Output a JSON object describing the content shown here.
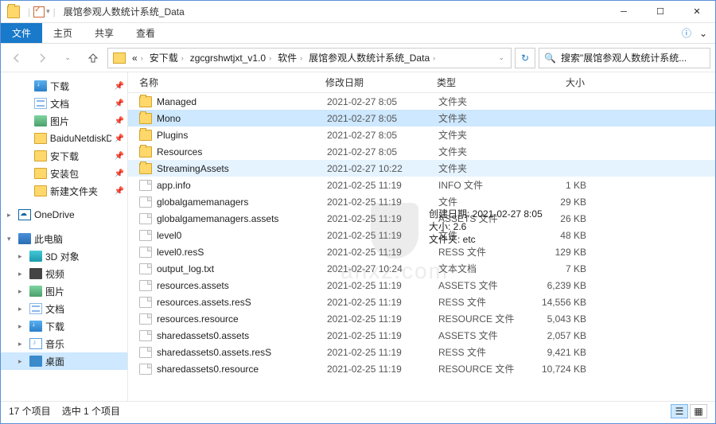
{
  "title": "展馆参观人数统计系统_Data",
  "ribbon": {
    "file": "文件",
    "home": "主页",
    "share": "共享",
    "view": "查看"
  },
  "breadcrumb": [
    "安下载",
    "zgcgrshwtjxt_v1.0",
    "软件",
    "展馆参观人数统计系统_Data"
  ],
  "search_placeholder": "搜索\"展馆参观人数统计系统...",
  "tree": {
    "quick": [
      {
        "label": "下载",
        "icon": "dl",
        "pin": true
      },
      {
        "label": "文档",
        "icon": "doc",
        "pin": true
      },
      {
        "label": "图片",
        "icon": "img",
        "pin": true
      },
      {
        "label": "BaiduNetdiskD",
        "icon": "folder",
        "pin": true
      },
      {
        "label": "安下载",
        "icon": "folder",
        "pin": true
      },
      {
        "label": "安装包",
        "icon": "folder",
        "pin": true
      },
      {
        "label": "新建文件夹",
        "icon": "folder",
        "pin": true
      }
    ],
    "onedrive": "OneDrive",
    "thispc": "此电脑",
    "pc": [
      {
        "label": "3D 对象",
        "icon": "cube"
      },
      {
        "label": "视频",
        "icon": "vid"
      },
      {
        "label": "图片",
        "icon": "img"
      },
      {
        "label": "文档",
        "icon": "doc"
      },
      {
        "label": "下载",
        "icon": "dl"
      },
      {
        "label": "音乐",
        "icon": "mus"
      },
      {
        "label": "桌面",
        "icon": "desk",
        "sel": true
      }
    ]
  },
  "cols": {
    "name": "名称",
    "date": "修改日期",
    "type": "类型",
    "size": "大小"
  },
  "rows": [
    {
      "n": "Managed",
      "d": "2021-02-27 8:05",
      "t": "文件夹",
      "s": "",
      "f": "folder"
    },
    {
      "n": "Mono",
      "d": "2021-02-27 8:05",
      "t": "文件夹",
      "s": "",
      "f": "folder",
      "sel": true
    },
    {
      "n": "Plugins",
      "d": "2021-02-27 8:05",
      "t": "文件夹",
      "s": "",
      "f": "folder"
    },
    {
      "n": "Resources",
      "d": "2021-02-27 8:05",
      "t": "文件夹",
      "s": "",
      "f": "folder"
    },
    {
      "n": "StreamingAssets",
      "d": "2021-02-27 10:22",
      "t": "文件夹",
      "s": "",
      "f": "folder",
      "hov": true
    },
    {
      "n": "app.info",
      "d": "2021-02-25 11:19",
      "t": "INFO 文件",
      "s": "1 KB",
      "f": "file"
    },
    {
      "n": "globalgamemanagers",
      "d": "2021-02-25 11:19",
      "t": "文件",
      "s": "29 KB",
      "f": "file"
    },
    {
      "n": "globalgamemanagers.assets",
      "d": "2021-02-25 11:19",
      "t": "ASSETS 文件",
      "s": "26 KB",
      "f": "file"
    },
    {
      "n": "level0",
      "d": "2021-02-25 11:19",
      "t": "文件",
      "s": "48 KB",
      "f": "file"
    },
    {
      "n": "level0.resS",
      "d": "2021-02-25 11:19",
      "t": "RESS 文件",
      "s": "129 KB",
      "f": "file"
    },
    {
      "n": "output_log.txt",
      "d": "2021-02-27 10:24",
      "t": "文本文档",
      "s": "7 KB",
      "f": "file"
    },
    {
      "n": "resources.assets",
      "d": "2021-02-25 11:19",
      "t": "ASSETS 文件",
      "s": "6,239 KB",
      "f": "file"
    },
    {
      "n": "resources.assets.resS",
      "d": "2021-02-25 11:19",
      "t": "RESS 文件",
      "s": "14,556 KB",
      "f": "file"
    },
    {
      "n": "resources.resource",
      "d": "2021-02-25 11:19",
      "t": "RESOURCE 文件",
      "s": "5,043 KB",
      "f": "file"
    },
    {
      "n": "sharedassets0.assets",
      "d": "2021-02-25 11:19",
      "t": "ASSETS 文件",
      "s": "2,057 KB",
      "f": "file"
    },
    {
      "n": "sharedassets0.assets.resS",
      "d": "2021-02-25 11:19",
      "t": "RESS 文件",
      "s": "9,421 KB",
      "f": "file"
    },
    {
      "n": "sharedassets0.resource",
      "d": "2021-02-25 11:19",
      "t": "RESOURCE 文件",
      "s": "10,724 KB",
      "f": "file"
    }
  ],
  "tooltip": {
    "l1": "创建日期: 2021-02-27 8:05",
    "l2": "大小: 2.6",
    "l3": "文件夹: etc"
  },
  "watermark": "anxz.com",
  "status": {
    "count": "17 个项目",
    "sel": "选中 1 个项目"
  }
}
